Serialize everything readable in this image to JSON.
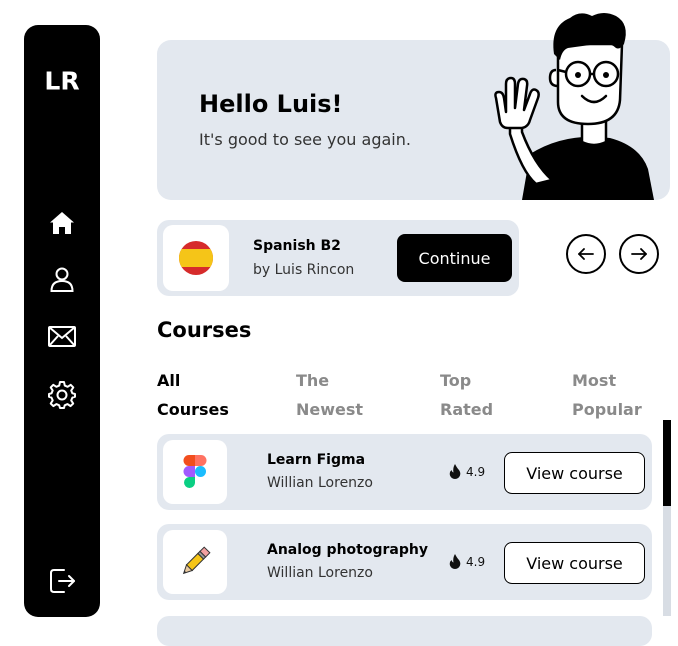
{
  "sidebar": {
    "logo": "LR",
    "items": [
      {
        "name": "home",
        "icon": "home-icon"
      },
      {
        "name": "profile",
        "icon": "user-icon"
      },
      {
        "name": "messages",
        "icon": "mail-icon"
      },
      {
        "name": "settings",
        "icon": "gear-icon"
      }
    ],
    "logout_icon": "logout-icon"
  },
  "hero": {
    "title": "Hello Luis!",
    "subtitle": "It's good to see you again."
  },
  "current_course": {
    "title": "Spanish B2",
    "author": "by Luis Rincon",
    "icon": "spain-flag-icon",
    "button_label": "Continue"
  },
  "carousel": {
    "prev_icon": "arrow-left-icon",
    "next_icon": "arrow-right-icon"
  },
  "courses": {
    "heading": "Courses",
    "tabs": [
      {
        "line1": "All",
        "line2": "Courses",
        "active": true
      },
      {
        "line1": "The",
        "line2": "Newest",
        "active": false
      },
      {
        "line1": "Top",
        "line2": "Rated",
        "active": false
      },
      {
        "line1": "Most",
        "line2": "Popular",
        "active": false
      }
    ],
    "items": [
      {
        "title": "Learn Figma",
        "author": "Willian Lorenzo",
        "rating": "4.9",
        "button_label": "View course",
        "icon": "figma-icon"
      },
      {
        "title": "Analog photography",
        "author": "Willian Lorenzo",
        "rating": "4.9",
        "button_label": "View course",
        "icon": "pencil-icon"
      }
    ]
  },
  "colors": {
    "sidebar": "#000000",
    "card_bg": "#e3e8ef",
    "tab_inactive": "#8a8a8a",
    "flag_red": "#d62b2b",
    "flag_yellow": "#f5c518"
  }
}
